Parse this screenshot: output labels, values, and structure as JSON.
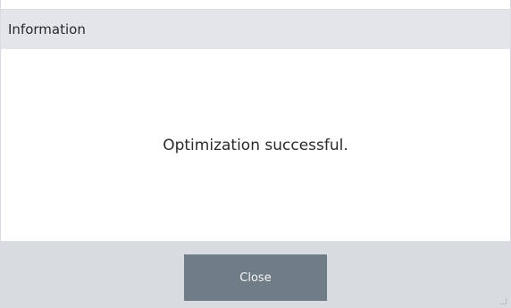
{
  "dialog": {
    "title": "Information",
    "message": "Optimization successful.",
    "close_label": "Close"
  },
  "colors": {
    "title_bar": "#e3e5ea",
    "footer": "#d8dbe0",
    "button": "#707c86",
    "button_text": "#f3f4f6",
    "text": "#2b2b2b"
  }
}
